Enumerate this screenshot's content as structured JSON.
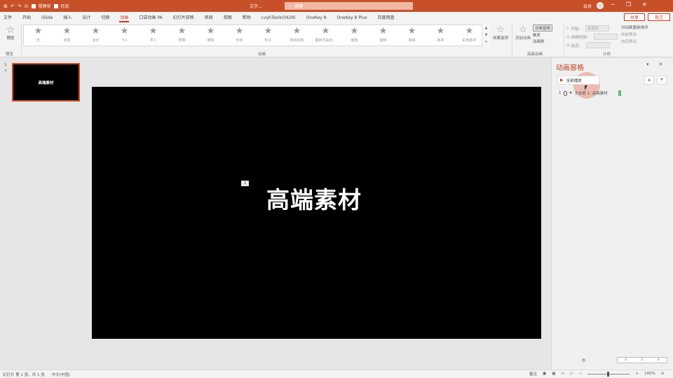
{
  "titlebar": {
    "qat": [
      "⊞",
      "↶",
      "↷",
      "⊙"
    ],
    "qat_labels": [
      "视频状",
      "形态"
    ],
    "doc_title": "文字…",
    "search_placeholder": "搜索",
    "user": "会员",
    "window_controls": [
      "─",
      "❐",
      "✕"
    ]
  },
  "tabs": [
    "文件",
    "开始",
    "iSlide",
    "插入",
    "设计",
    "切换",
    "动画",
    "口袋动画 PA",
    "幻灯片放映",
    "审阅",
    "视图",
    "帮助",
    "LvyhTools(0429)",
    "OneKey 8",
    "OneKey 8 Plus",
    "百度网盘"
  ],
  "active_tab": "动画",
  "share_label": "共享",
  "comment_label": "批注",
  "ribbon": {
    "preview_label": "预览",
    "preview_group": "预览",
    "gallery": [
      {
        "icon": "★",
        "label": "无"
      },
      {
        "icon": "★",
        "label": "出现"
      },
      {
        "icon": "★",
        "label": "淡化"
      },
      {
        "icon": "★",
        "label": "飞入"
      },
      {
        "icon": "★",
        "label": "浮入"
      },
      {
        "icon": "★",
        "label": "劈裂"
      },
      {
        "icon": "★",
        "label": "擦除"
      },
      {
        "icon": "★",
        "label": "形状"
      },
      {
        "icon": "★",
        "label": "轮子"
      },
      {
        "icon": "★",
        "label": "随机线条"
      },
      {
        "icon": "★",
        "label": "翻转式由远…"
      },
      {
        "icon": "★",
        "label": "缩放"
      },
      {
        "icon": "★",
        "label": "旋转"
      },
      {
        "icon": "★",
        "label": "弹跳"
      },
      {
        "icon": "★",
        "label": "脉冲"
      },
      {
        "icon": "★",
        "label": "彩色脉冲"
      }
    ],
    "gallery_scroll": [
      "▲",
      "▼",
      "≡"
    ],
    "animation_group": "动画",
    "effect_options": "效果选项",
    "add_animation": "添加动画",
    "advanced": [
      "动画窗格",
      "触发",
      "动画刷"
    ],
    "advanced_group": "高级动画",
    "timing": {
      "start_label": "开始:",
      "start_value": "单击时",
      "duration_label": "持续时间:",
      "delay_label": "延迟:"
    },
    "reorder_title": "对动画重新排序",
    "reorder": [
      "向前移动",
      "向后移动"
    ],
    "timing_group": "计时"
  },
  "thumbnails": [
    {
      "num": "1",
      "star": "★",
      "text": "高端素材"
    }
  ],
  "slide": {
    "title": "高端素材",
    "anim_tag": "1"
  },
  "anim_pane": {
    "title": "动画窗格",
    "controls": [
      "▾",
      "✕"
    ],
    "play_all": "全部播放",
    "arrows": [
      "▲",
      "▼"
    ],
    "items": [
      {
        "order": "1",
        "label": "文本框 1: 高端素材"
      }
    ],
    "seconds_label": "秒",
    "timeline_ticks": [
      "0",
      "2",
      "4"
    ]
  },
  "status": {
    "slide_info": "幻灯片 第 1 张，共 1 张",
    "lang": "中文(中国)",
    "notes": "备注",
    "zoom": "100%"
  }
}
